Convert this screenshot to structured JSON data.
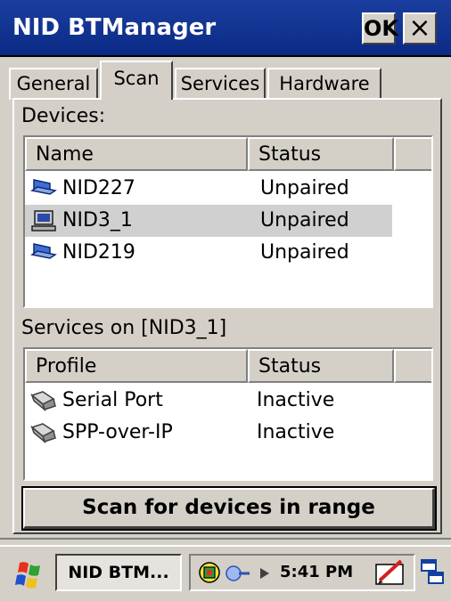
{
  "window": {
    "title": "NID BTManager",
    "ok_label": "OK",
    "close_label": "×"
  },
  "tabs": [
    {
      "label": "General"
    },
    {
      "label": "Scan"
    },
    {
      "label": "Services"
    },
    {
      "label": "Hardware"
    }
  ],
  "active_tab": "Scan",
  "devices": {
    "label": "Devices:",
    "columns": [
      "Name",
      "Status"
    ],
    "rows": [
      {
        "name": "NID227",
        "status": "Unpaired",
        "icon": "laptop-icon"
      },
      {
        "name": "NID3_1",
        "status": "Unpaired",
        "icon": "desktop-computer-icon",
        "selected": true
      },
      {
        "name": "NID219",
        "status": "Unpaired",
        "icon": "laptop-icon"
      }
    ]
  },
  "services": {
    "label": "Services on [NID3_1]",
    "columns": [
      "Profile",
      "Status"
    ],
    "rows": [
      {
        "profile": "Serial Port",
        "status": "Inactive",
        "icon": "serial-cable-icon"
      },
      {
        "profile": "SPP-over-IP",
        "status": "Inactive",
        "icon": "serial-cable-icon"
      }
    ]
  },
  "scan_button": {
    "label": "Scan for devices in range"
  },
  "taskbar": {
    "task_label": "NID BTM...",
    "clock": "5:41 PM"
  },
  "colors": {
    "titlebar": "#0b2a86",
    "face": "#d4d0c8",
    "selection": "#d0d0d0"
  }
}
